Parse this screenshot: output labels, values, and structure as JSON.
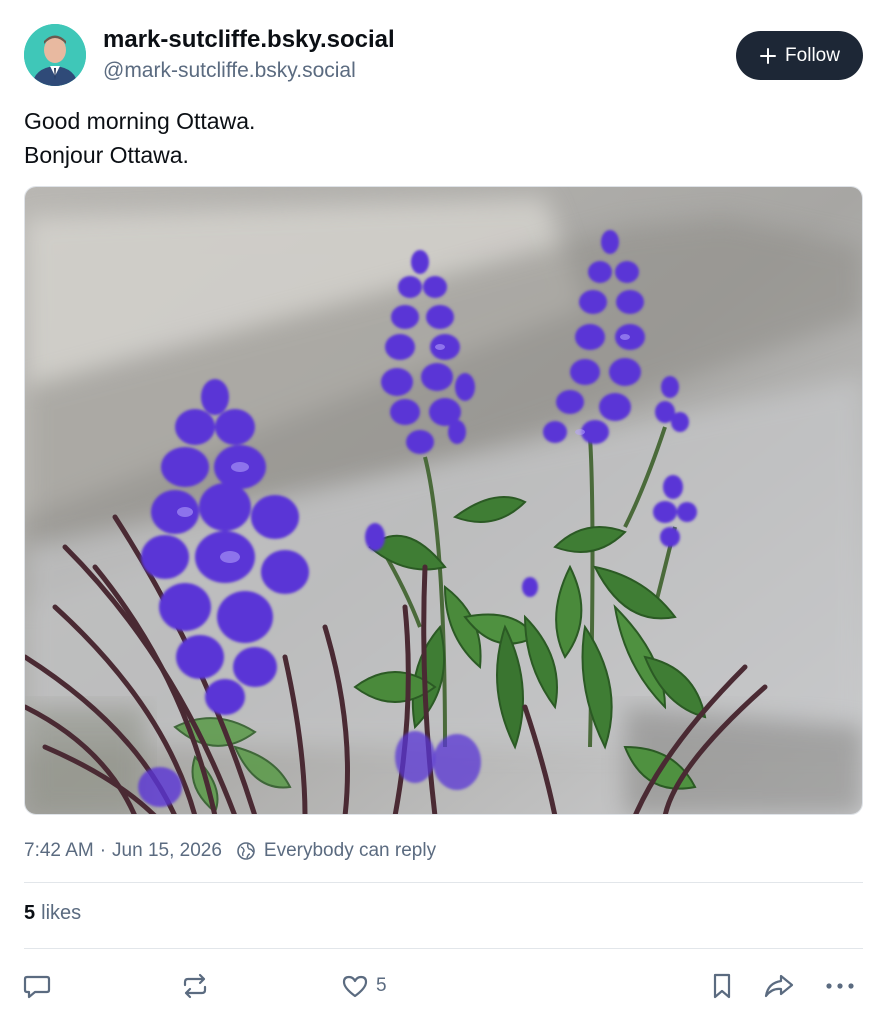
{
  "post": {
    "author": {
      "display_name": "mark-sutcliffe.bsky.social",
      "handle": "@mark-sutcliffe.bsky.social"
    },
    "follow_label": "Follow",
    "text_lines": [
      "Good morning Ottawa.",
      "Bonjour Ottawa."
    ],
    "image": {
      "subject": "purple salvia flowers with green leaves and dark ornamental grass"
    },
    "meta": {
      "time": "7:42 AM",
      "separator": "·",
      "date": "Jun 15, 2026",
      "reply_setting": "Everybody can reply"
    },
    "likes": {
      "count": "5",
      "label": "likes"
    },
    "actions": {
      "like_count": "5"
    }
  },
  "icons": {
    "follow": "plus-icon",
    "reply_setting": "globe-icon",
    "reply": "speech-bubble-icon",
    "repost": "repost-icon",
    "like": "heart-icon",
    "bookmark": "bookmark-icon",
    "share": "share-arrow-icon",
    "more": "ellipsis-icon"
  },
  "colors": {
    "follow_button_bg": "#1d2736",
    "secondary_text": "#5b6b80",
    "avatar_bg": "#3fc7b8",
    "flower": "#5a35d6"
  }
}
